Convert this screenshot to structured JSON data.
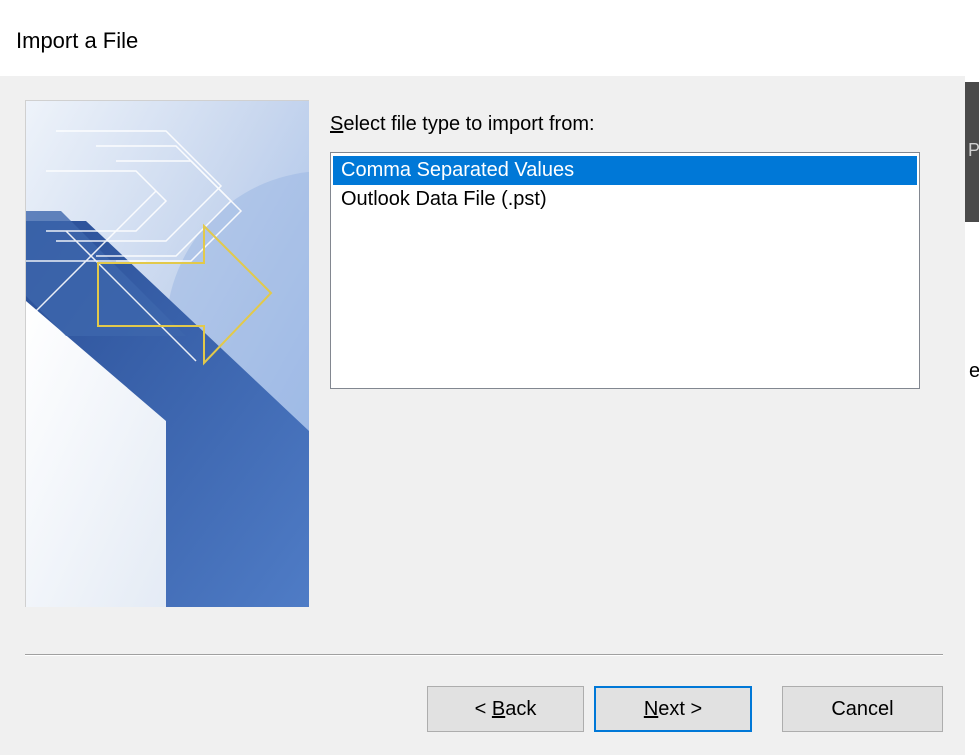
{
  "dialog": {
    "title": "Import a File"
  },
  "prompt": {
    "accel": "S",
    "rest": "elect file type to import from:"
  },
  "file_types": [
    {
      "label": "Comma Separated Values",
      "selected": true
    },
    {
      "label": "Outlook Data File (.pst)",
      "selected": false
    }
  ],
  "buttons": {
    "back": {
      "prefix": "< ",
      "accel": "B",
      "rest": "ack"
    },
    "next": {
      "prefix": "",
      "accel": "N",
      "rest": "ext >"
    },
    "cancel": {
      "label": "Cancel"
    }
  },
  "colors": {
    "selection": "#0078d7",
    "wizard_blue": "#2f5ca8",
    "wizard_arrow": "#e2c94a"
  },
  "background_edge": {
    "glyph_top": "P",
    "glyph_bottom": "e"
  }
}
